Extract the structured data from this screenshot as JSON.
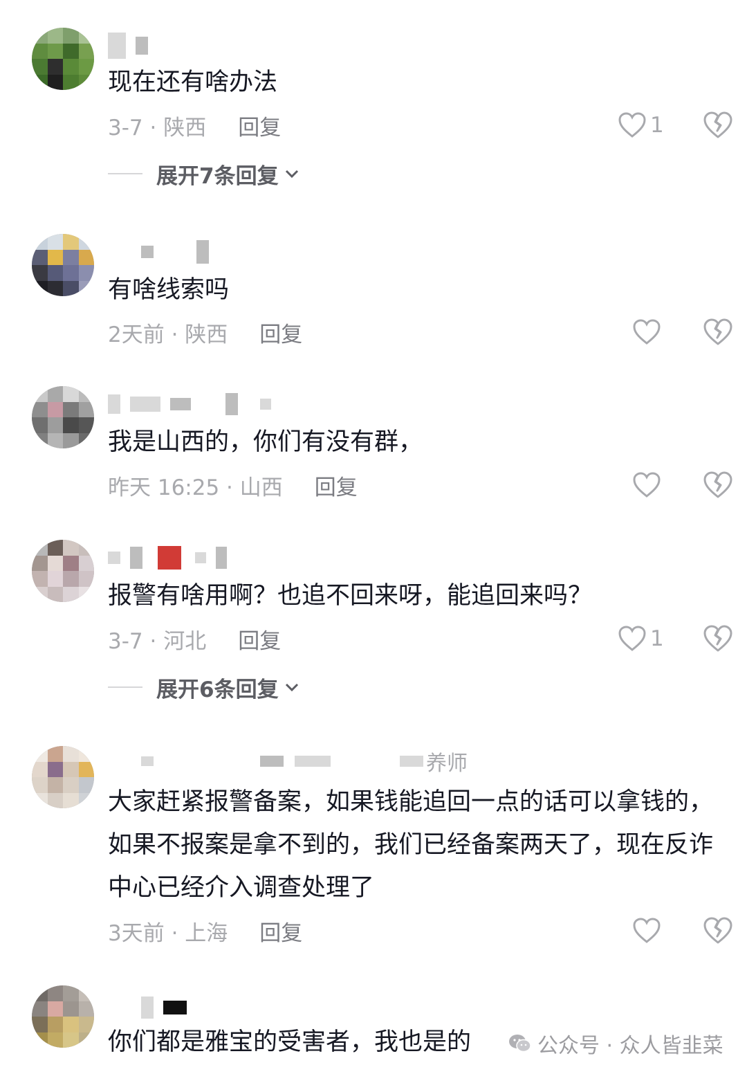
{
  "comments": [
    {
      "name_tail": "",
      "text": "现在还有啥办法",
      "date_loc": "3-7 · 陕西",
      "reply": "回复",
      "likes": "1",
      "expand": "展开7条回复"
    },
    {
      "name_tail": "",
      "text": "有啥线索吗",
      "date_loc": "2天前 · 陕西",
      "reply": "回复",
      "likes": ""
    },
    {
      "name_tail": "",
      "text": "我是山西的，你们有没有群，",
      "date_loc": "昨天 16:25 · 山西",
      "reply": "回复",
      "likes": ""
    },
    {
      "name_tail": "",
      "text": "报警有啥用啊？也追不回来呀，能追回来吗？",
      "date_loc": "3-7 · 河北",
      "reply": "回复",
      "likes": "1",
      "expand": "展开6条回复"
    },
    {
      "name_tail": "养师",
      "text": "大家赶紧报警备案，如果钱能追回一点的话可以拿钱的，如果不报案是拿不到的，我们已经备案两天了，现在反诈中心已经介入调查处理了",
      "date_loc": "3天前 · 上海",
      "reply": "回复",
      "likes": ""
    },
    {
      "name_tail": "",
      "text": "你们都是雅宝的受害者，我也是的"
    }
  ],
  "watermark": "公众号 · 众人皆韭菜",
  "icons": {
    "like": "heart-outline-icon",
    "dislike": "broken-heart-icon",
    "expand": "chevron-down-icon",
    "watermark": "wechat-icon"
  }
}
